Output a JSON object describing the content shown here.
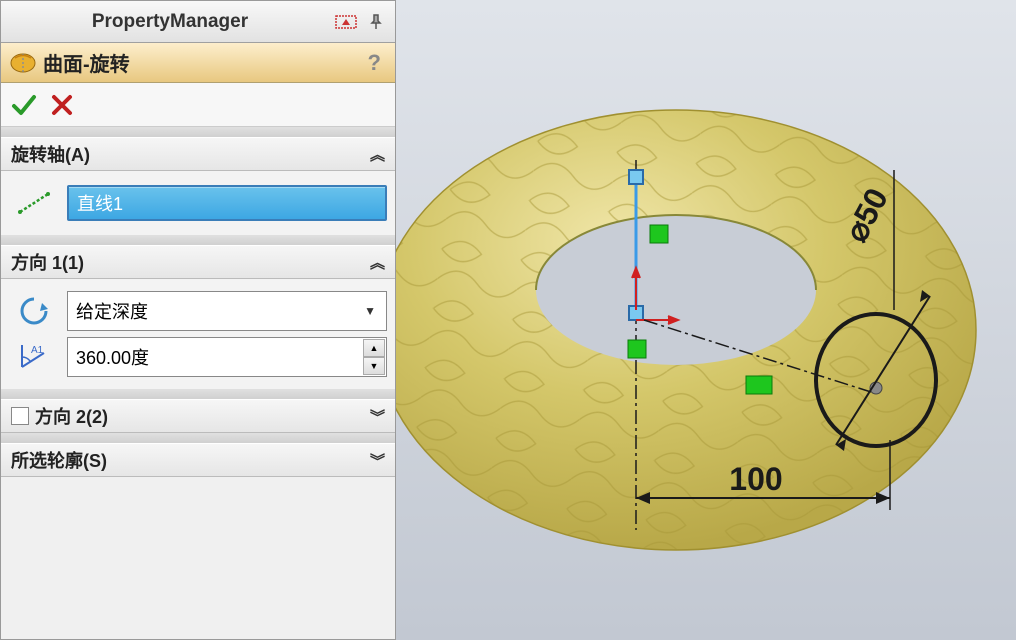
{
  "header": {
    "title": "PropertyManager"
  },
  "feature": {
    "title": "曲面-旋转"
  },
  "sections": {
    "axis": {
      "label": "旋转轴(A)",
      "value": "直线1"
    },
    "direction1": {
      "label": "方向 1(1)",
      "end_condition": "给定深度",
      "angle": "360.00度"
    },
    "direction2": {
      "label": "方向 2(2)"
    },
    "contours": {
      "label": "所选轮廓(S)"
    }
  },
  "viewport": {
    "dim1": "⌀50",
    "dim2": "100"
  }
}
